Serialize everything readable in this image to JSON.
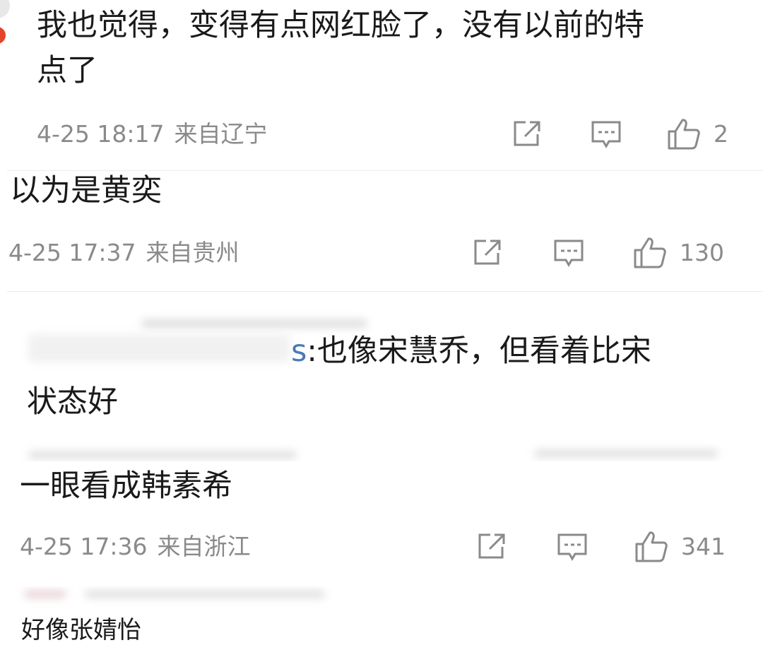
{
  "colors": {
    "text": "#1a1a1a",
    "meta": "#8a8a8a",
    "mention": "#4a7ab8",
    "divider": "#ececec",
    "avatar_badge": "#e5432b"
  },
  "icons": {
    "share": "share-icon",
    "reply": "comment-icon",
    "like": "thumbs-up-icon"
  },
  "comments": [
    {
      "text_line1": "我也觉得，变得有点网红脸了，没有以前的特",
      "text_line2": "点了",
      "date": "4-25 18:17",
      "location": "来自辽宁",
      "likes": "2"
    },
    {
      "text": "以为是黄奕",
      "date": "4-25 17:37",
      "location": "来自贵州",
      "likes": "130"
    },
    {
      "mention": "s",
      "text_line1": ":也像宋慧乔，但看着比宋",
      "text_line2": "状态好"
    },
    {
      "text": "一眼看成韩素希",
      "date": "4-25 17:36",
      "location": "来自浙江",
      "likes": "341"
    },
    {
      "text": "好像张婧怡"
    }
  ]
}
